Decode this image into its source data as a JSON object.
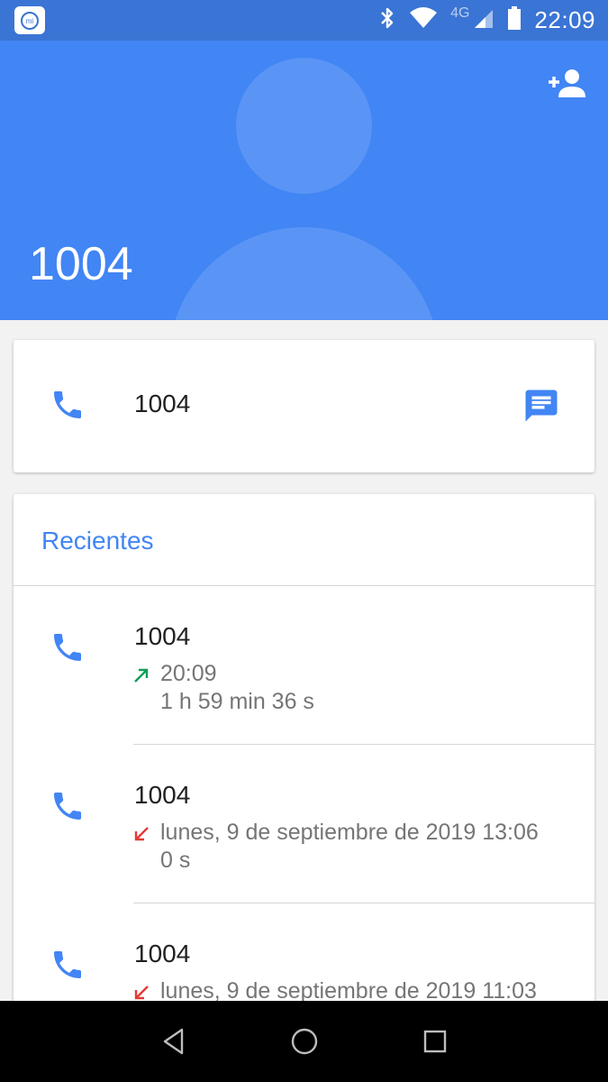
{
  "status_bar": {
    "network_label": "4G",
    "time": "22:09",
    "icons": [
      "mi-app-icon",
      "bluetooth-icon",
      "wifi-icon",
      "signal-icon",
      "battery-icon"
    ]
  },
  "header": {
    "contact_name": "1004",
    "action_icon": "add-contact-icon",
    "background_color": "#4285f4"
  },
  "number_card": {
    "number": "1004",
    "call_icon": "phone-icon",
    "message_icon": "message-icon"
  },
  "recents": {
    "title": "Recientes",
    "items": [
      {
        "name": "1004",
        "direction": "outgoing",
        "time": "20:09",
        "duration": "1 h 59 min 36 s"
      },
      {
        "name": "1004",
        "direction": "missed",
        "time": "lunes, 9 de septiembre de 2019 13:06",
        "duration": "0 s"
      },
      {
        "name": "1004",
        "direction": "missed",
        "time": "lunes, 9 de septiembre de 2019 11:03",
        "duration": ""
      }
    ]
  },
  "nav_bar": {
    "icons": [
      "back-icon",
      "home-icon",
      "recents-icon"
    ]
  },
  "colors": {
    "accent": "#4285f4",
    "outgoing": "#0f9d58",
    "missed": "#e53935",
    "status_bar": "#3a74d4"
  }
}
